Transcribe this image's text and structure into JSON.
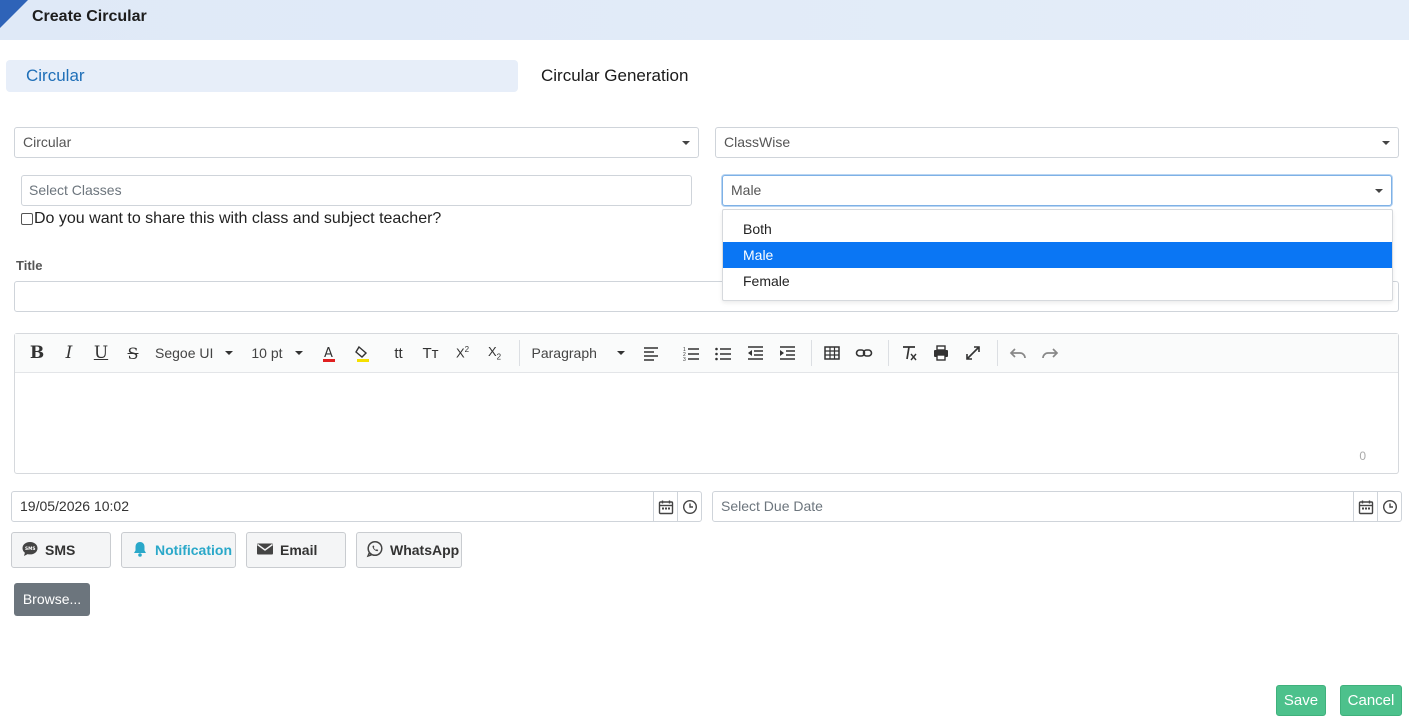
{
  "header": {
    "title": "Create Circular"
  },
  "tabs": [
    {
      "label": "Circular",
      "active": true
    },
    {
      "label": "Circular Generation",
      "active": false
    }
  ],
  "form": {
    "type_select": "Circular",
    "scope_select": "ClassWise",
    "classes_placeholder": "Select Classes",
    "gender_select": "Male",
    "gender_options": [
      "Both",
      "Male",
      "Female"
    ],
    "gender_selected_option": "Male",
    "share_checkbox_label": "Do you want to share this with class and subject teacher?",
    "share_checked": false,
    "title_label": "Title",
    "title_value": ""
  },
  "editor": {
    "font_family": "Segoe UI",
    "font_size": "10 pt",
    "block_format": "Paragraph",
    "char_count": "0",
    "colors": {
      "text_underline": "#e02020",
      "highlight_underline": "#f5e000"
    }
  },
  "dates": {
    "publish_value": "19/05/2026 10:02",
    "due_placeholder": "Select Due Date"
  },
  "channels": [
    {
      "label": "SMS",
      "icon": "sms-icon",
      "active": false
    },
    {
      "label": "Notification",
      "icon": "bell-icon",
      "active": true
    },
    {
      "label": "Email",
      "icon": "envelope-icon",
      "active": false
    },
    {
      "label": "WhatsApp",
      "icon": "whatsapp-icon",
      "active": false
    }
  ],
  "browse_label": "Browse...",
  "actions": {
    "save": "Save",
    "cancel": "Cancel"
  },
  "colors": {
    "accent": "#1f6fb8",
    "selected_option": "#0a76f4",
    "success": "#4dc18c",
    "notification": "#2aa8c9"
  }
}
